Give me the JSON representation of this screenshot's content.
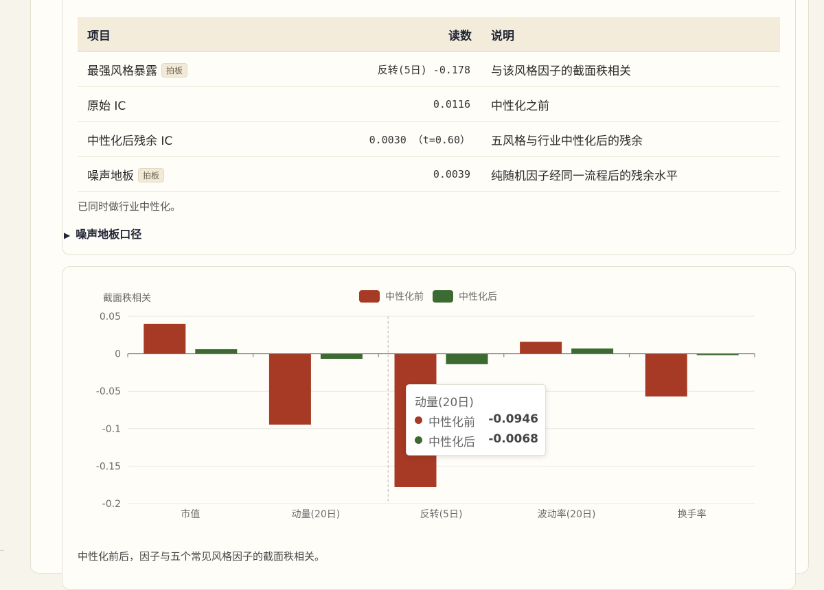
{
  "table": {
    "headers": [
      "项目",
      "读数",
      "说明"
    ],
    "rows": [
      {
        "item": "最强风格暴露",
        "badge": "拍板",
        "reading": "反转(5日) -0.178",
        "desc": "与该风格因子的截面秩相关"
      },
      {
        "item": "原始 IC",
        "badge": "",
        "reading": "0.0116",
        "desc": "中性化之前"
      },
      {
        "item": "中性化后残余 IC",
        "badge": "",
        "reading": "0.0030 （t=0.60）",
        "desc": "五风格与行业中性化后的残余"
      },
      {
        "item": "噪声地板",
        "badge": "拍板",
        "reading": "0.0039",
        "desc": "纯随机因子经同一流程后的残余水平"
      }
    ]
  },
  "note": "已同时做行业中性化。",
  "details_label": "噪声地板口径",
  "chart_data": {
    "type": "bar",
    "ylabel": "截面秩相关",
    "categories": [
      "市值",
      "动量(20日)",
      "反转(5日)",
      "波动率(20日)",
      "换手率"
    ],
    "series": [
      {
        "name": "中性化前",
        "color": "#a63a24",
        "values": [
          0.04,
          -0.0946,
          -0.178,
          0.016,
          -0.057
        ]
      },
      {
        "name": "中性化后",
        "color": "#3b6b30",
        "values": [
          0.006,
          -0.0068,
          -0.014,
          0.007,
          -0.002
        ]
      }
    ],
    "ylim": [
      -0.2,
      0.05
    ],
    "yticks": [
      0.05,
      0,
      -0.05,
      -0.1,
      -0.15,
      -0.2
    ],
    "ytick_labels": [
      "0.05",
      "0",
      "-0.05",
      "-0.1",
      "-0.15",
      "-0.2"
    ],
    "grid": true,
    "legend": "top-center",
    "hover_category_index": 1
  },
  "tooltip": {
    "title": "动量(20日)",
    "rows": [
      {
        "name": "中性化前",
        "value": "-0.0946",
        "color": "#a63a24"
      },
      {
        "name": "中性化后",
        "value": "-0.0068",
        "color": "#3b6b30"
      }
    ]
  },
  "caption": "中性化前后，因子与五个常见风格因子的截面秩相关。"
}
